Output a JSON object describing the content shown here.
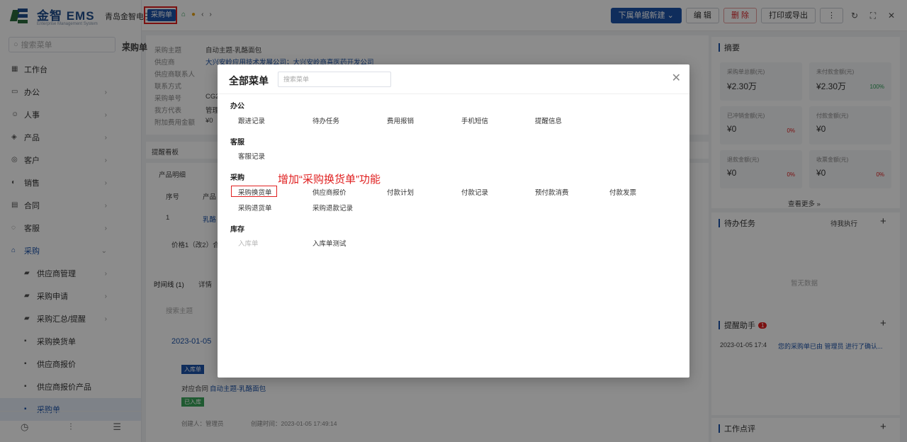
{
  "app": {
    "brand": "金智 EMS",
    "brand_sub": "Enterprise Management System",
    "company": "青岛金智电子"
  },
  "topbar": {
    "active_tab": "采购单",
    "buttons": {
      "create_downstream": "下属单据新建",
      "edit": "编 辑",
      "delete": "删 除",
      "print_export": "打印或导出"
    }
  },
  "sidebar": {
    "search_placeholder": "搜索菜单",
    "items": [
      {
        "label": "工作台",
        "icon": "dashboard-icon"
      },
      {
        "label": "办公",
        "icon": "office-icon"
      },
      {
        "label": "人事",
        "icon": "people-icon"
      },
      {
        "label": "产品",
        "icon": "product-icon"
      },
      {
        "label": "客户",
        "icon": "customer-icon"
      },
      {
        "label": "销售",
        "icon": "sales-icon"
      },
      {
        "label": "合同",
        "icon": "contract-icon"
      },
      {
        "label": "客服",
        "icon": "service-icon"
      },
      {
        "label": "采购",
        "icon": "purchase-icon"
      }
    ],
    "subitems": [
      "供应商管理",
      "采购申请",
      "采购汇总/提醒",
      "采购换货单",
      "供应商报价",
      "供应商报价产品",
      "采购单"
    ]
  },
  "detail": {
    "page_title": "采购单",
    "fields": [
      {
        "label": "采购主题",
        "value": "自动主题-乳酪面包"
      },
      {
        "label": "供应商",
        "value": "大兴安岭应用技术发展公司；大兴安岭商喜医药开发公司"
      },
      {
        "label": "供应商联系人",
        "value": ""
      },
      {
        "label": "联系方式",
        "value": ""
      },
      {
        "label": "采购单号",
        "value": "CG2"
      },
      {
        "label": "我方代表",
        "value": "管理"
      },
      {
        "label": "附加费用金额",
        "value": "¥0"
      }
    ],
    "reminder_board": "提醒看板",
    "product_detail": "产品明细",
    "table_headers": [
      "序号",
      "产品"
    ],
    "table_row": {
      "index": "1",
      "product": "乳酪"
    },
    "spec_text": "价格1（改2）合",
    "timeline_tab": "时间线 (1)",
    "detail_tab": "详情",
    "search_subject_placeholder": "搜索主题",
    "timeline_date": "2023-01-05",
    "entry_tag": "入库单",
    "contract_label": "对应合同",
    "contract_link": "自动主题-乳酪面包",
    "status": "已入库",
    "creator": "创建人：管理员",
    "created_at": "创建时间：2023-01-05 17:49:14"
  },
  "right_panel": {
    "summary_title": "摘要",
    "stats": [
      {
        "label": "采购单总额(元)",
        "value": "¥2.30万",
        "pct": ""
      },
      {
        "label": "未付款金额(元)",
        "value": "¥2.30万",
        "pct": "100%"
      },
      {
        "label": "已冲销金额(元)",
        "value": "¥0",
        "pct": "0%"
      },
      {
        "label": "付款金额(元)",
        "value": "¥0",
        "pct": ""
      },
      {
        "label": "退款金额(元)",
        "value": "¥0",
        "pct": "0%"
      },
      {
        "label": "收票金额(元)",
        "value": "¥0",
        "pct": "0%"
      }
    ],
    "view_more": "查看更多 »",
    "todo_title": "待办任务",
    "todo_filter": "待我执行",
    "empty_text": "暂无数据",
    "assistant_title": "提醒助手",
    "assistant_badge": "1",
    "assistant_entry_time": "2023-01-05 17:4",
    "assistant_entry_text": "您的采购单已由 管理员 进行了确认...",
    "work_comment_title": "工作点评"
  },
  "modal": {
    "title": "全部菜单",
    "search_placeholder": "搜索菜单",
    "annotation": "增加“采购换货单”功能",
    "sections": [
      {
        "title": "办公",
        "items": [
          "跟进记录",
          "待办任务",
          "费用报销",
          "手机短信",
          "提醒信息"
        ]
      },
      {
        "title": "客服",
        "items": [
          "客服记录"
        ]
      },
      {
        "title": "采购",
        "items": [
          "采购换货单",
          "供应商报价",
          "付款计划",
          "付款记录",
          "预付款消费",
          "付款发票",
          "采购退货单",
          "采购退款记录"
        ]
      },
      {
        "title": "库存",
        "items": [
          "入库单",
          "入库单测试"
        ]
      }
    ]
  }
}
